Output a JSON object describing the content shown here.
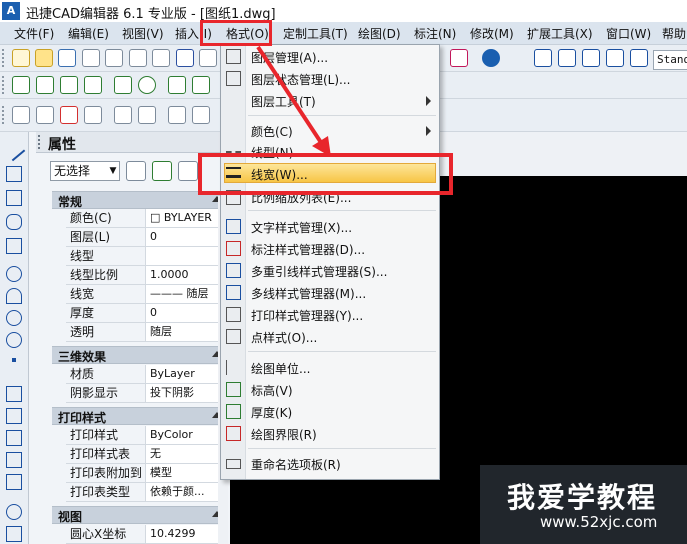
{
  "window": {
    "title": "迅捷CAD编辑器 6.1 专业版  - [图纸1.dwg]",
    "logo": "A"
  },
  "menubar": {
    "items": [
      "文件(F)",
      "编辑(E)",
      "视图(V)",
      "插入(I)",
      "格式(O)",
      "定制工具(T)",
      "绘图(D)",
      "标注(N)",
      "修改(M)",
      "扩展工具(X)",
      "窗口(W)",
      "帮助"
    ]
  },
  "toolbar": {
    "style_field": "Standa"
  },
  "properties": {
    "title": "属性",
    "selection": "无选择",
    "sections": [
      {
        "title": "常规",
        "rows": [
          [
            "颜色(C)",
            "□ BYLAYER"
          ],
          [
            "图层(L)",
            "0"
          ],
          [
            "线型",
            ""
          ],
          [
            "线型比例",
            "1.0000"
          ],
          [
            "线宽",
            "——— 随层"
          ],
          [
            "厚度",
            "0"
          ],
          [
            "透明",
            "随层"
          ]
        ]
      },
      {
        "title": "三维效果",
        "rows": [
          [
            "材质",
            "ByLayer"
          ],
          [
            "阴影显示",
            "投下阴影"
          ]
        ]
      },
      {
        "title": "打印样式",
        "rows": [
          [
            "打印样式",
            "ByColor"
          ],
          [
            "打印样式表",
            "无"
          ],
          [
            "打印表附加到",
            "模型"
          ],
          [
            "打印表类型",
            "依赖于颜..."
          ]
        ]
      },
      {
        "title": "视图",
        "rows": [
          [
            "圆心X坐标",
            "10.4299"
          ]
        ]
      }
    ]
  },
  "format_menu": {
    "items": [
      {
        "label": "图层管理(A)...",
        "submenu": false
      },
      {
        "label": "图层状态管理(L)...",
        "submenu": false
      },
      {
        "label": "图层工具(T)",
        "submenu": true
      },
      {
        "label": "颜色(C)",
        "submenu": true
      },
      {
        "label": "线型(N)...",
        "submenu": false
      },
      {
        "label": "线宽(W)...",
        "submenu": false,
        "highlighted": true
      },
      {
        "label": "比例缩放列表(E)...",
        "submenu": false
      },
      {
        "label": "文字样式管理(X)...",
        "submenu": false
      },
      {
        "label": "标注样式管理器(D)...",
        "submenu": false
      },
      {
        "label": "多重引线样式管理器(S)...",
        "submenu": false
      },
      {
        "label": "多线样式管理器(M)...",
        "submenu": false
      },
      {
        "label": "打印样式管理器(Y)...",
        "submenu": false
      },
      {
        "label": "点样式(O)...",
        "submenu": false
      },
      {
        "label": "绘图单位...",
        "submenu": false
      },
      {
        "label": "标高(V)",
        "submenu": false
      },
      {
        "label": "厚度(K)",
        "submenu": false
      },
      {
        "label": "绘图界限(R)",
        "submenu": false
      },
      {
        "label": "重命名选项板(R)",
        "submenu": false
      }
    ]
  },
  "watermark": {
    "text": "我爱学教程",
    "url": "www.52xjc.com"
  },
  "colors": {
    "annotation_red": "#e8262c",
    "highlight": "#f7c546",
    "canvas": "#000000"
  }
}
